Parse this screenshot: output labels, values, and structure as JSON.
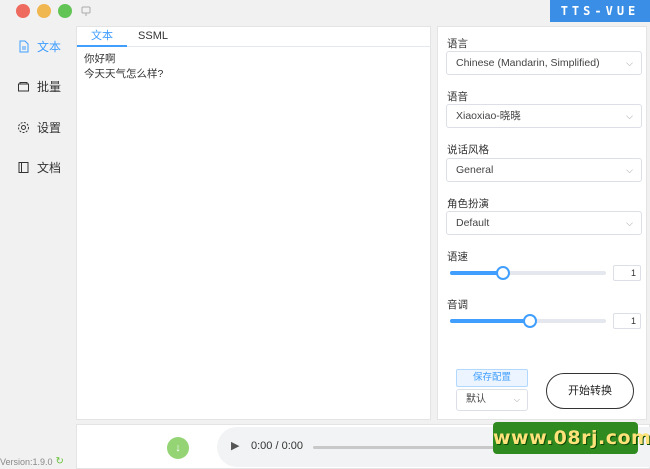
{
  "app": {
    "brand": "TTS-VUE",
    "version": "Version:1.9.0"
  },
  "sidebar": {
    "items": [
      {
        "label": "文本",
        "icon": "document-icon",
        "active": true
      },
      {
        "label": "批量",
        "icon": "folder-icon",
        "active": false
      },
      {
        "label": "设置",
        "icon": "gear-icon",
        "active": false
      },
      {
        "label": "文档",
        "icon": "book-icon",
        "active": false
      }
    ]
  },
  "editor": {
    "tabs": [
      {
        "label": "文本",
        "active": true
      },
      {
        "label": "SSML",
        "active": false
      }
    ],
    "text": "你好啊\n今天天气怎么样?"
  },
  "panel": {
    "language": {
      "label": "语言",
      "value": "Chinese (Mandarin, Simplified)"
    },
    "voice": {
      "label": "语音",
      "value": "Xiaoxiao-晓晓"
    },
    "style": {
      "label": "说话风格",
      "value": "General"
    },
    "role": {
      "label": "角色扮演",
      "value": "Default"
    },
    "rate": {
      "label": "语速",
      "value": "1",
      "level": 0.34
    },
    "pitch": {
      "label": "音调",
      "value": "1",
      "level": 0.51
    },
    "save_label": "保存配置",
    "preset_value": "默认",
    "start_label": "开始转换"
  },
  "player": {
    "time": "0:00 / 0:00"
  },
  "watermark": "www.08rj.com",
  "colors": {
    "accent": "#409eff",
    "download": "#95d475"
  }
}
